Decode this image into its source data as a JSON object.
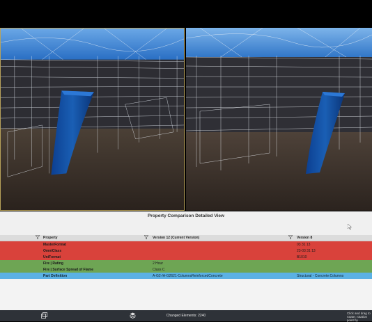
{
  "panel": {
    "title": "Property Comparison Detailed View"
  },
  "grid": {
    "headers": {
      "property": "Property",
      "v12": "Version 12 (Current Version)",
      "v8": "Version 8"
    },
    "rows": [
      {
        "property": "MasterFormat",
        "v12": "",
        "v8": "03 31 13",
        "status": "removed",
        "color": "#d9423b"
      },
      {
        "property": "OmniClass",
        "v12": "",
        "v8": "23-03 31 13",
        "status": "removed",
        "color": "#d9423b"
      },
      {
        "property": "UniFormat",
        "v12": "",
        "v8": "B1010",
        "status": "removed",
        "color": "#d9423b"
      },
      {
        "property": "Fire | Rating",
        "v12": "2 Hour",
        "v8": "",
        "status": "added",
        "color": "#6ea554"
      },
      {
        "property": "Fire | Surface Spread of Flame",
        "v12": "Class C",
        "v8": "",
        "status": "added",
        "color": "#6ea554"
      },
      {
        "property": "Part Definition",
        "v12": "A-G2-/A-G2621-ColumnsReinforcedConcrete",
        "v8": "Structural - Concrete:Columns",
        "status": "modified",
        "color": "#5bb1e4"
      }
    ]
  },
  "statusbar": {
    "changed": "Changed Elements: 2240",
    "hint": "Click and drag to rotate; rotation point by"
  },
  "icons": {
    "compare": "overlay-compare-icon",
    "layers": "layers-icon",
    "filter": "filter-icon",
    "cursor": "mouse-cursor-icon"
  },
  "colors": {
    "removed": "#d9423b",
    "added": "#6ea554",
    "modified": "#5bb1e4",
    "selected_viewport_border": "#b9a35a",
    "highlighted_column": "#1a5fb4"
  }
}
